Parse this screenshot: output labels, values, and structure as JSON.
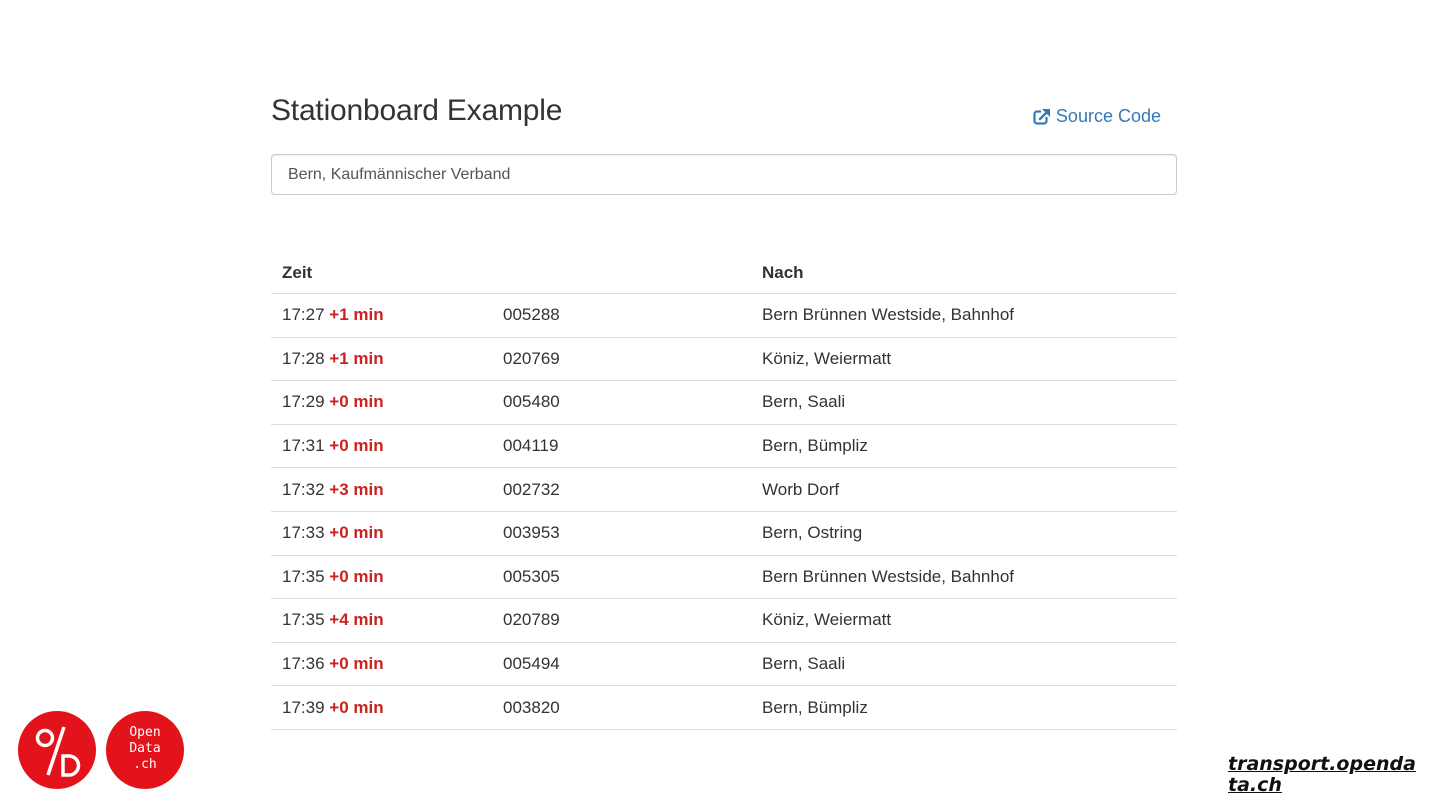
{
  "header": {
    "title": "Stationboard Example",
    "source_link_label": "Source Code"
  },
  "search": {
    "value": "Bern, Kaufmännischer Verband"
  },
  "table": {
    "headers": [
      "Zeit",
      "",
      "Nach"
    ],
    "rows": [
      {
        "time": "17:27",
        "delay": "+1 min",
        "number": "005288",
        "destination": "Bern Brünnen Westside, Bahnhof"
      },
      {
        "time": "17:28",
        "delay": "+1 min",
        "number": "020769",
        "destination": "Köniz, Weiermatt"
      },
      {
        "time": "17:29",
        "delay": "+0 min",
        "number": "005480",
        "destination": "Bern, Saali"
      },
      {
        "time": "17:31",
        "delay": "+0 min",
        "number": "004119",
        "destination": "Bern, Bümpliz"
      },
      {
        "time": "17:32",
        "delay": "+3 min",
        "number": "002732",
        "destination": "Worb Dorf"
      },
      {
        "time": "17:33",
        "delay": "+0 min",
        "number": "003953",
        "destination": "Bern, Ostring"
      },
      {
        "time": "17:35",
        "delay": "+0 min",
        "number": "005305",
        "destination": "Bern Brünnen Westside, Bahnhof"
      },
      {
        "time": "17:35",
        "delay": "+4 min",
        "number": "020789",
        "destination": "Köniz, Weiermatt"
      },
      {
        "time": "17:36",
        "delay": "+0 min",
        "number": "005494",
        "destination": "Bern, Saali"
      },
      {
        "time": "17:39",
        "delay": "+0 min",
        "number": "003820",
        "destination": "Bern, Bümpliz"
      }
    ]
  },
  "footer": {
    "logo_left_text": "%D",
    "logo_right_text": "Open\nData\n.ch",
    "link_text": "transport.opendata.ch"
  },
  "colors": {
    "link": "#337ab7",
    "delay": "#c9231f",
    "logo": "#e3131b"
  },
  "icons": {
    "source_link": "external-link-icon"
  }
}
